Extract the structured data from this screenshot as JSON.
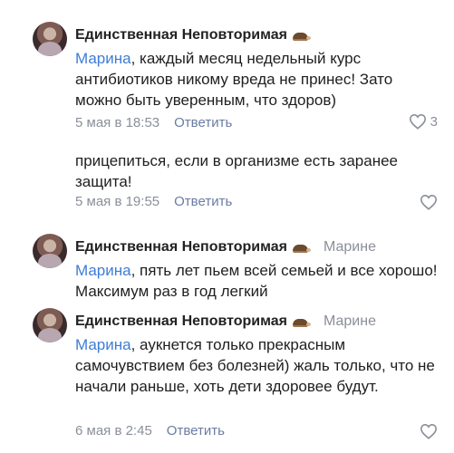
{
  "comments": [
    {
      "author": "Единственная Неповторимая",
      "reply_to": "",
      "mention": "Марина",
      "text": ", каждый месяц недельный курс антибиотиков никому вреда не принес! Зато можно быть уверенным, что здоров)",
      "time": "5 мая в 18:53",
      "reply_label": "Ответить",
      "likes": "3"
    },
    {
      "author": "",
      "reply_to": "",
      "mention": "",
      "text": "прицепиться, если в организме есть заранее защита!",
      "time": "5 мая в 19:55",
      "reply_label": "Ответить",
      "likes": ""
    },
    {
      "author": "Единственная Неповторимая",
      "reply_to": "Марине",
      "mention": "Марина",
      "text": ", пять лет пьем всей семьей и все хорошо! Максимум раз в год легкий",
      "time": "",
      "reply_label": "",
      "likes": ""
    },
    {
      "author": "Единственная Неповторимая",
      "reply_to": "Марине",
      "mention": "Марина",
      "text": ", аукнется только прекрасным самочувствием без болезней) жаль только, что не начали раньше, хоть дети здоровее будут.",
      "time": "6 мая в 2:45",
      "reply_label": "Ответить",
      "likes": ""
    }
  ],
  "icons": {
    "author_emoji": "hedgehog-emoji-icon",
    "like": "heart-icon"
  },
  "colors": {
    "mention": "#3d7cd6",
    "meta": "#8a8f99",
    "reply_button": "#6b7ba3"
  }
}
